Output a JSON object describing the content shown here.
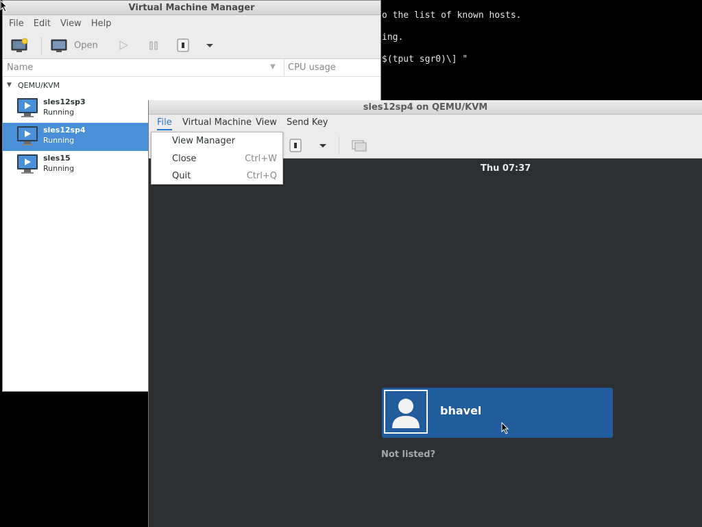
{
  "terminal": {
    "lines": [
      "o the list of known hosts.",
      "ing.",
      "$(tput sgr0)\\] \""
    ]
  },
  "manager": {
    "title": "Virtual Machine Manager",
    "menu": [
      "File",
      "Edit",
      "View",
      "Help"
    ],
    "toolbar": {
      "open_label": "Open"
    },
    "columns": {
      "name": "Name",
      "cpu": "CPU usage"
    },
    "group": "QEMU/KVM",
    "vms": [
      {
        "name": "sles12sp3",
        "status": "Running"
      },
      {
        "name": "sles12sp4",
        "status": "Running"
      },
      {
        "name": "sles15",
        "status": "Running"
      }
    ],
    "selected_vm": "sles12sp4"
  },
  "console": {
    "title": "sles12sp4 on QEMU/KVM",
    "menu": [
      "File",
      "Virtual Machine",
      "View",
      "Send Key"
    ],
    "active_menu": "File",
    "clock": "Thu 07:37",
    "user": "bhavel",
    "not_listed": "Not listed?"
  },
  "file_menu": {
    "items": [
      {
        "label": "View Manager",
        "accel": ""
      },
      {
        "label": "Close",
        "accel": "Ctrl+W"
      },
      {
        "label": "Quit",
        "accel": "Ctrl+Q"
      }
    ]
  },
  "colors": {
    "selection": "#4a90d9",
    "user_button": "#215d9c",
    "console_bg": "#2b2f31"
  }
}
